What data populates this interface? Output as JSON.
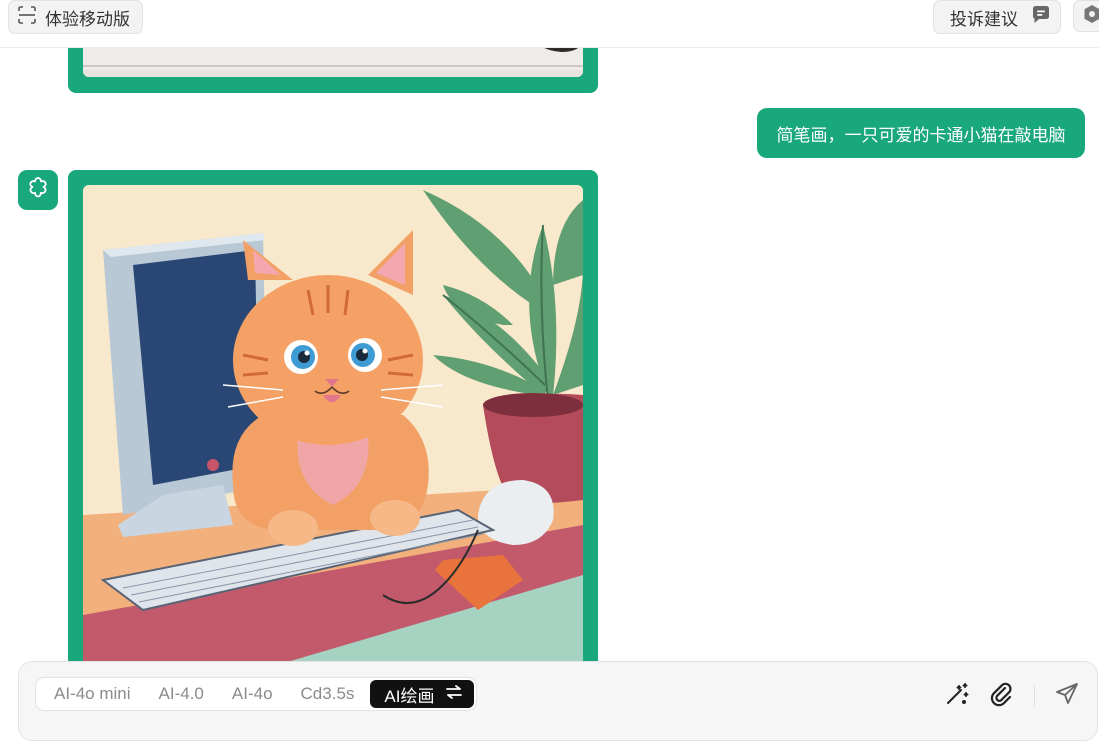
{
  "header": {
    "mobile_label": "体验移动版",
    "feedback_label": "投诉建议"
  },
  "conversation": {
    "user_message": "简笔画，一只可爱的卡通小猫在敲电脑"
  },
  "composer": {
    "models": [
      "AI-4o mini",
      "AI-4.0",
      "AI-4o",
      "Cd3.5s"
    ],
    "active_model": "AI绘画"
  },
  "colors": {
    "accent": "#19a77c",
    "active_tab_bg": "#111111"
  },
  "icons": {
    "mobile": "scan-icon",
    "feedback": "chat-bubble-icon",
    "settings": "hexagon-icon",
    "avatar": "flower-outline-icon",
    "switch": "swap-arrows-icon",
    "magic": "magic-wand-icon",
    "attach": "paperclip-icon",
    "send": "send-icon"
  }
}
